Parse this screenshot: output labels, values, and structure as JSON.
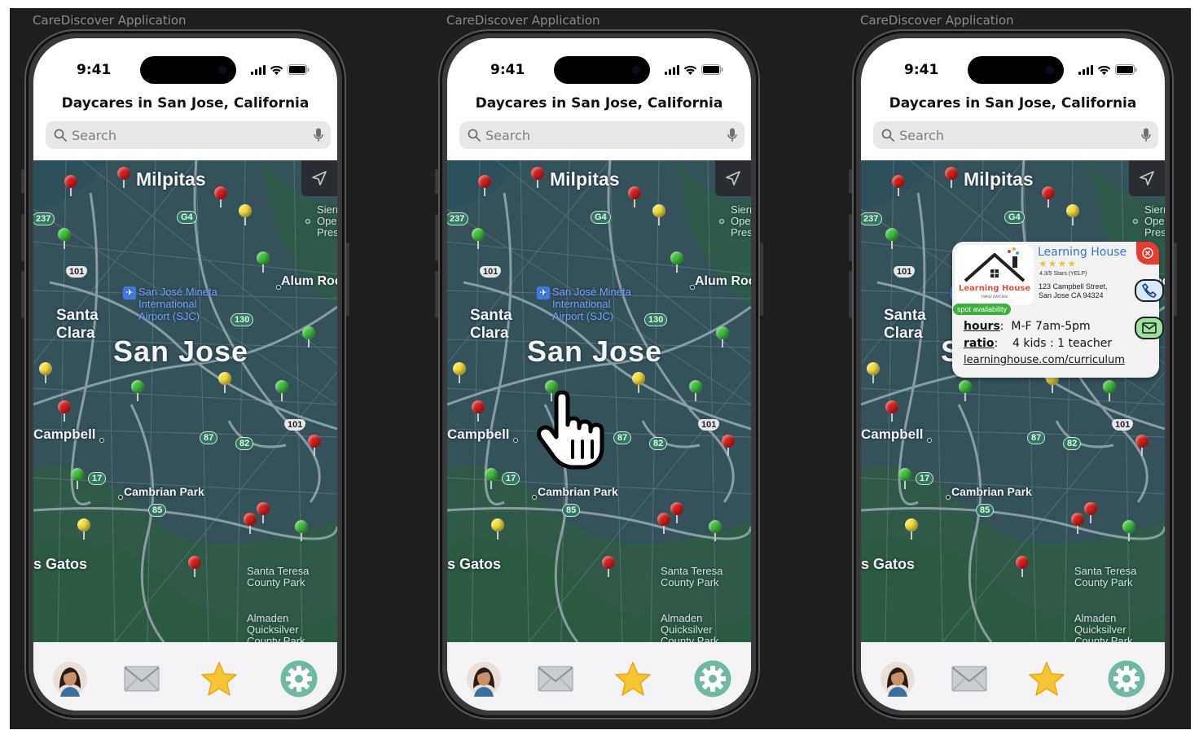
{
  "frame_label": "CareDiscover Application",
  "status": {
    "time": "9:41"
  },
  "header": {
    "title": "Daycares in San Jose, California"
  },
  "search": {
    "placeholder": "Search"
  },
  "map": {
    "places": {
      "milpitas": "Milpitas",
      "santa_clara": "Santa\nClara",
      "san_jose": "San Jose",
      "campbell": "Campbell",
      "cambrian_park": "Cambrian Park",
      "los_gatos": "s Gatos",
      "alum_rock": "Alum Roc"
    },
    "airport": "San José Mineta\nInternational\nAirport (SJC)",
    "parks": {
      "sierra": "Sierr\nOpen\nPres",
      "santa_teresa": "Santa Teresa\nCounty Park",
      "almaden": "Almaden\nQuicksilver\nCounty Park"
    },
    "shields": [
      "237",
      "G4",
      "101",
      "130",
      "87",
      "82",
      "101",
      "17",
      "85"
    ]
  },
  "popup": {
    "name": "Learning House",
    "stars": "★★★★",
    "rating": "4.3/5 Stars (YELP)",
    "address": "123 Campbell Street,\nSan Jose CA 94324",
    "badge": "spot availability",
    "hours_label": "hours",
    "hours": "M-F 7am-5pm",
    "ratio_label": "ratio",
    "ratio": "4 kids : 1 teacher",
    "link": "learninghouse.com/curriculum",
    "logo_text": "Learning House",
    "logo_sub": "FAMILY DAYCARE"
  },
  "colors": {
    "background": "#1e1e1e",
    "map": "#2e4a48",
    "pin_red": "#d51f1f",
    "pin_yellow": "#f3dd3c",
    "pin_green": "#3fbf3c",
    "settings": "#6fb9a3"
  },
  "tabs": [
    {
      "icon": "avatar-icon"
    },
    {
      "icon": "mail-icon"
    },
    {
      "icon": "star-icon"
    },
    {
      "icon": "gear-icon"
    }
  ]
}
